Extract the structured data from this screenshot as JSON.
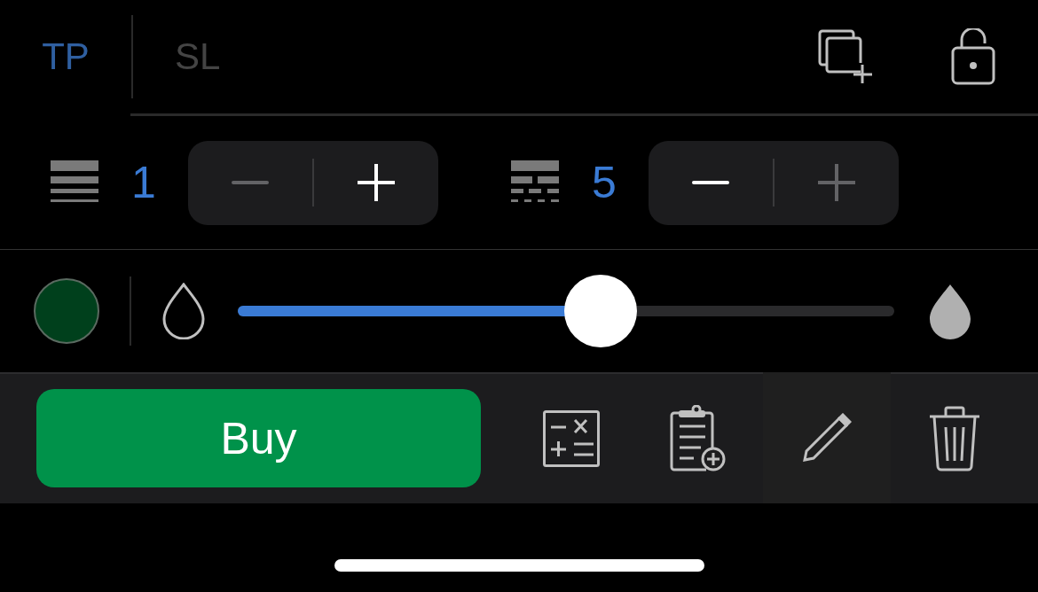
{
  "tabs": [
    {
      "label": "TP",
      "selected": true
    },
    {
      "label": "SL",
      "selected": false
    }
  ],
  "steppers": [
    {
      "kind": "lines",
      "value": "1",
      "minus_disabled": true,
      "plus_disabled": false
    },
    {
      "kind": "dashes",
      "value": "5",
      "minus_disabled": false,
      "plus_disabled": true
    }
  ],
  "color_swatch": {
    "color": "#00401c"
  },
  "opacity_slider": {
    "level": 0.553
  },
  "buy_button": {
    "label": "Buy"
  },
  "tools": [
    {
      "kind": "calculator",
      "selected": false
    },
    {
      "kind": "clipboard",
      "selected": false
    },
    {
      "kind": "pencil",
      "selected": true
    },
    {
      "kind": "trash",
      "selected": false
    }
  ]
}
